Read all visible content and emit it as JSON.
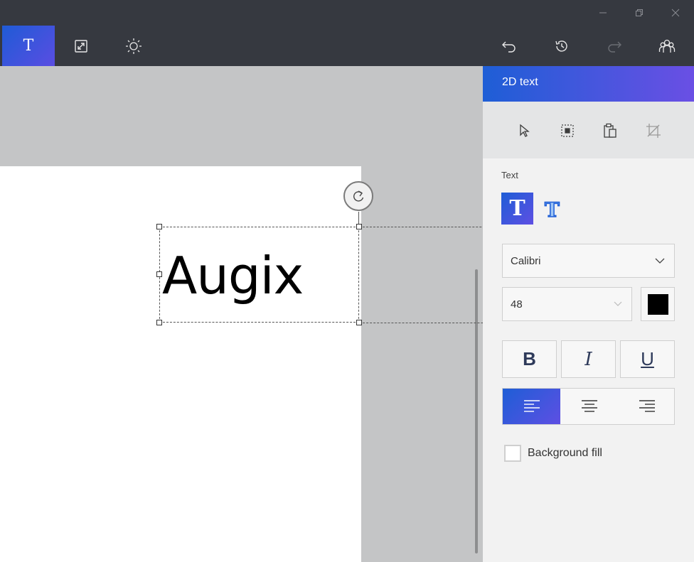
{
  "window": {
    "controls": {
      "minimize": "minimize-icon",
      "restore": "restore-icon",
      "close": "close-icon"
    }
  },
  "toolbar": {
    "text_tool_label": "T",
    "icons": [
      "text-tool-icon",
      "resize-canvas-icon",
      "brightness-icon",
      "undo-icon",
      "history-icon",
      "redo-icon",
      "people-icon"
    ]
  },
  "canvas": {
    "text_content": "Augix"
  },
  "panel": {
    "title": "2D text",
    "text_section_label": "Text",
    "font": {
      "value": "Calibri"
    },
    "size": {
      "value": "48"
    },
    "color": "#000000",
    "format": {
      "bold_label": "B",
      "italic_label": "I",
      "underline_label": "U"
    },
    "background_fill_label": "Background fill",
    "background_fill_checked": false,
    "accent_color": "#1e5ed6"
  }
}
